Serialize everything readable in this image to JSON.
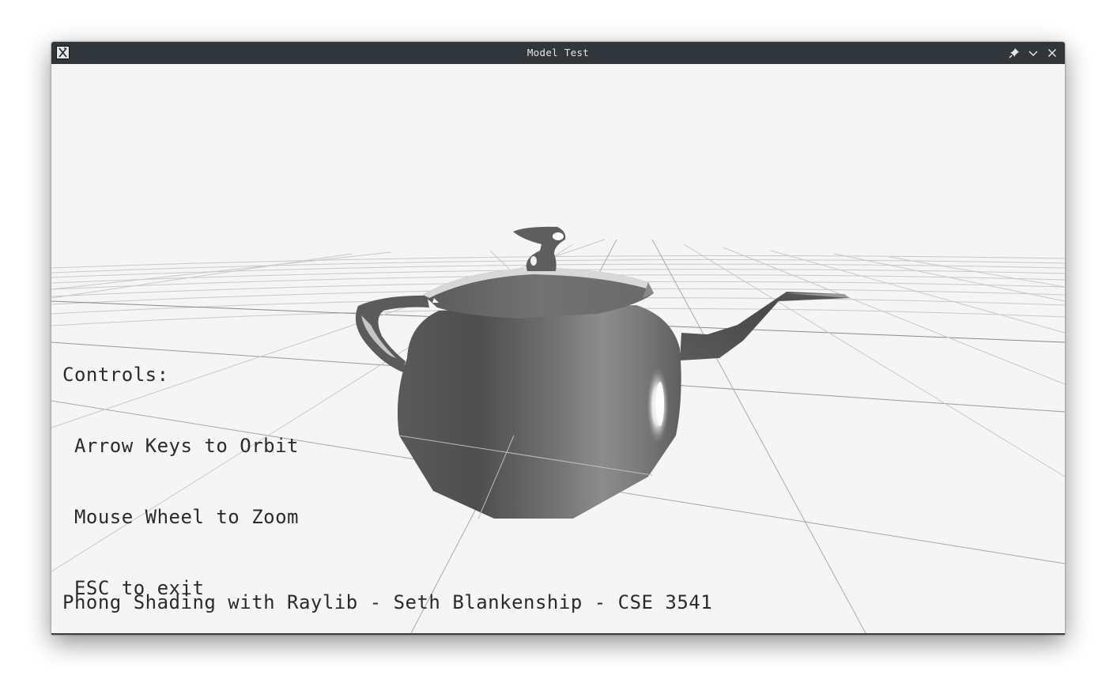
{
  "window": {
    "title": "Model Test"
  },
  "titlebar": {
    "icons": [
      "x-app-icon",
      "pin-icon",
      "minimize-chevron-icon",
      "close-icon"
    ]
  },
  "overlay": {
    "controls_heading": "Controls:",
    "controls": [
      " Arrow Keys to Orbit",
      " Mouse Wheel to Zoom",
      " ESC to exit"
    ],
    "credit": "Phong Shading with Raylib - Seth Blankenship - CSE 3541"
  },
  "colors": {
    "titlebar": "#31363b",
    "viewport_background": "#f5f5f5",
    "text": "#2a2a2a",
    "model_shade_dark": "#3c3c3c",
    "model_shade_light": "#c8c8c8"
  }
}
